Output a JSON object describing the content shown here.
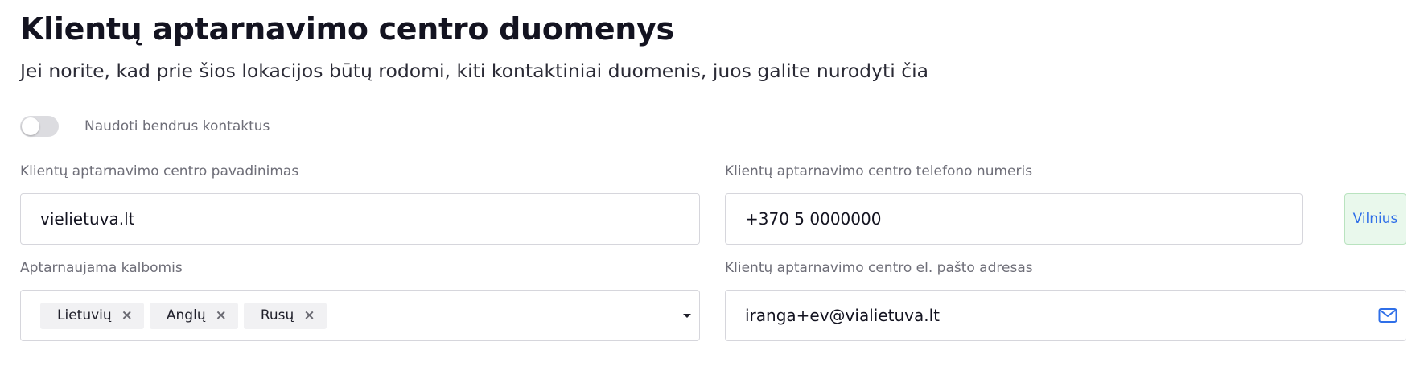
{
  "header": {
    "title": "Klientų aptarnavimo centro duomenys",
    "subtitle": "Jei norite, kad prie šios lokacijos būtų rodomi, kiti kontaktiniai duomenis, juos galite nurodyti čia"
  },
  "toggle": {
    "label": "Naudoti bendrus kontaktus",
    "checked": false
  },
  "fields": {
    "name": {
      "label": "Klientų aptarnavimo centro pavadinimas",
      "value": "vielietuva.lt"
    },
    "phone": {
      "label": "Klientų aptarnavimo centro telefono numeris",
      "value": "+370 5 0000000",
      "addon": "Vilnius"
    },
    "languages": {
      "label": "Aptarnaujama kalbomis",
      "selected": [
        "Lietuvių",
        "Anglų",
        "Rusų"
      ],
      "remove_symbol": "×"
    },
    "email": {
      "label": "Klientų aptarnavimo centro el. pašto adresas",
      "value": "iranga+ev@vialietuva.lt",
      "icon": "envelope-icon"
    }
  },
  "colors": {
    "accent_blue": "#2f6fe8",
    "addon_bg": "#e9f8ec",
    "addon_border": "#b9e3bf",
    "toggle_off": "#dcdce0",
    "label_gray": "#6e6e78",
    "border": "#d6d6dc"
  }
}
